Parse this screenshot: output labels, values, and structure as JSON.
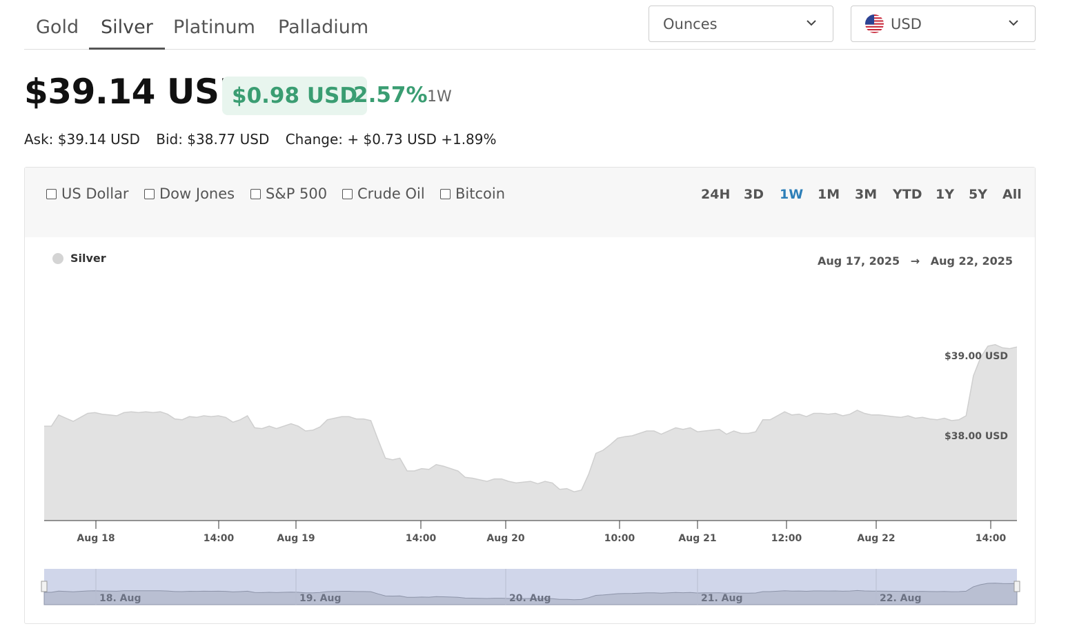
{
  "tabs": [
    {
      "label": "Gold",
      "active": false
    },
    {
      "label": "Silver",
      "active": true
    },
    {
      "label": "Platinum",
      "active": false
    },
    {
      "label": "Palladium",
      "active": false
    }
  ],
  "unit_select": {
    "value": "Ounces"
  },
  "currency_select": {
    "value": "USD",
    "flag": "us-flag-icon"
  },
  "price": {
    "current": "$39.14 USD",
    "change": "$0.98 USD",
    "change_pct": "2.57%",
    "period": "1W",
    "change_color": "#3a9d72"
  },
  "quote": {
    "ask": "Ask: $39.14 USD",
    "bid": "Bid: $38.77 USD",
    "change": "Change: + $0.73 USD +1.89%"
  },
  "compare": [
    "US Dollar",
    "Dow Jones",
    "S&P 500",
    "Crude Oil",
    "Bitcoin"
  ],
  "ranges": [
    {
      "label": "24H",
      "active": false
    },
    {
      "label": "3D",
      "active": false
    },
    {
      "label": "1W",
      "active": true
    },
    {
      "label": "1M",
      "active": false
    },
    {
      "label": "3M",
      "active": false
    },
    {
      "label": "YTD",
      "active": false
    },
    {
      "label": "1Y",
      "active": false
    },
    {
      "label": "5Y",
      "active": false
    },
    {
      "label": "All",
      "active": false
    }
  ],
  "legend": {
    "name": "Silver"
  },
  "date_range": {
    "from": "Aug 17, 2025",
    "arrow": "→",
    "to": "Aug 22, 2025"
  },
  "chart_data": {
    "type": "area",
    "series_name": "Silver",
    "y_unit": "USD",
    "x_ticks": [
      "Aug 18",
      "14:00",
      "Aug 19",
      "14:00",
      "Aug 20",
      "10:00",
      "Aug 21",
      "12:00",
      "Aug 22",
      "14:00"
    ],
    "y_ticks": [
      "$38.00 USD",
      "$39.00 USD"
    ],
    "navigator_labels": [
      "18. Aug",
      "19. Aug",
      "20. Aug",
      "21. Aug",
      "22. Aug"
    ],
    "values": [
      38.12,
      38.12,
      38.26,
      38.22,
      38.18,
      38.23,
      38.28,
      38.29,
      38.27,
      38.26,
      38.25,
      38.29,
      38.3,
      38.29,
      38.3,
      38.29,
      38.3,
      38.27,
      38.21,
      38.2,
      38.24,
      38.23,
      38.25,
      38.24,
      38.25,
      38.23,
      38.17,
      38.2,
      38.25,
      38.1,
      38.09,
      38.12,
      38.09,
      38.12,
      38.15,
      38.12,
      38.06,
      38.07,
      38.11,
      38.2,
      38.22,
      38.24,
      38.24,
      38.21,
      38.21,
      38.19,
      37.95,
      37.72,
      37.7,
      37.72,
      37.56,
      37.56,
      37.59,
      37.58,
      37.64,
      37.62,
      37.59,
      37.56,
      37.48,
      37.47,
      37.45,
      37.43,
      37.46,
      37.46,
      37.43,
      37.41,
      37.42,
      37.43,
      37.4,
      37.43,
      37.41,
      37.33,
      37.34,
      37.3,
      37.32,
      37.52,
      37.78,
      37.82,
      37.89,
      37.97,
      37.99,
      38.0,
      38.03,
      38.06,
      38.06,
      38.02,
      38.06,
      38.1,
      38.08,
      38.1,
      38.05,
      38.06,
      38.07,
      38.08,
      38.02,
      38.06,
      38.03,
      38.03,
      38.05,
      38.2,
      38.2,
      38.25,
      38.3,
      38.26,
      38.27,
      38.24,
      38.28,
      38.28,
      38.27,
      38.28,
      38.25,
      38.27,
      38.32,
      38.28,
      38.26,
      38.26,
      38.25,
      38.24,
      38.23,
      38.25,
      38.22,
      38.23,
      38.21,
      38.2,
      38.22,
      38.19,
      38.2,
      38.25,
      38.75,
      38.98,
      39.12,
      39.14,
      39.1,
      39.09,
      39.11
    ],
    "ylim": [
      36.89,
      39.99
    ]
  }
}
